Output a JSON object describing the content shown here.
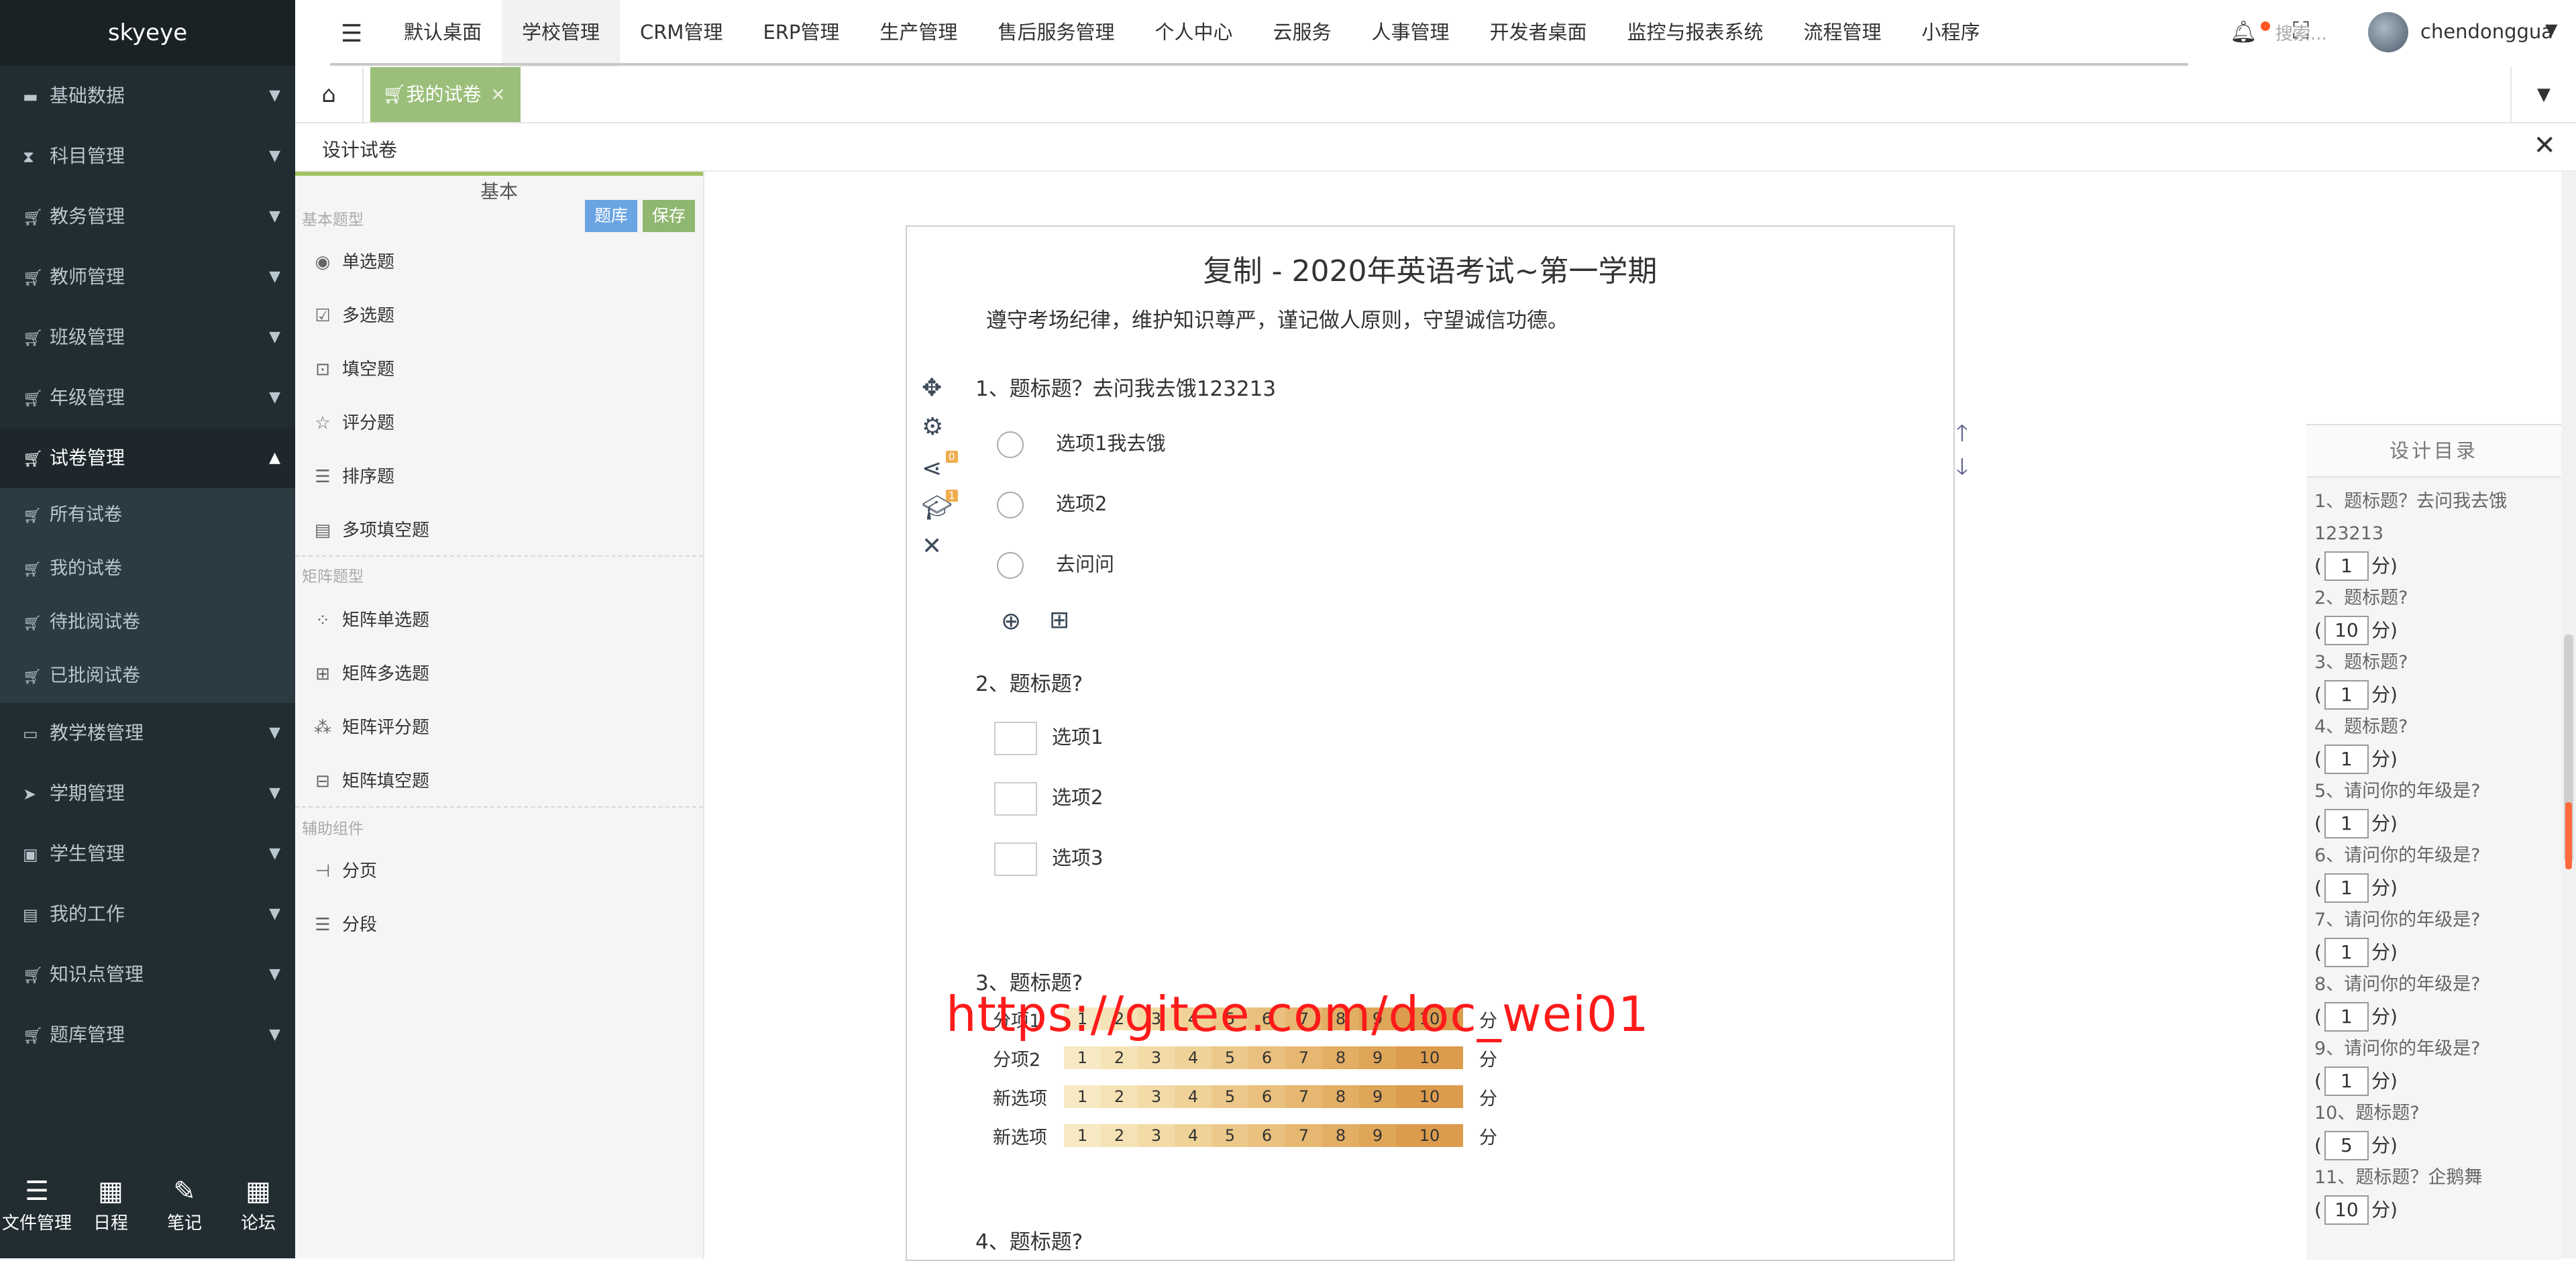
{
  "brand": "skyeye",
  "sidebar": {
    "items": [
      {
        "label": "基础数据",
        "icon": "folder-icon"
      },
      {
        "label": "科目管理",
        "icon": "hourglass-icon"
      },
      {
        "label": "教务管理",
        "icon": "cart-icon"
      },
      {
        "label": "教师管理",
        "icon": "cart-icon"
      },
      {
        "label": "班级管理",
        "icon": "cart-icon"
      },
      {
        "label": "年级管理",
        "icon": "cart-icon"
      },
      {
        "label": "试卷管理",
        "icon": "cart-icon",
        "open": true
      },
      {
        "label": "教学楼管理",
        "icon": "folder-open-icon"
      },
      {
        "label": "学期管理",
        "icon": "paper-plane-icon"
      },
      {
        "label": "学生管理",
        "icon": "id-badge-icon"
      },
      {
        "label": "我的工作",
        "icon": "archive-icon"
      },
      {
        "label": "知识点管理",
        "icon": "cart-icon"
      },
      {
        "label": "题库管理",
        "icon": "cart-icon"
      }
    ],
    "sub_items": [
      "所有试卷",
      "我的试卷",
      "待批阅试卷",
      "已批阅试卷"
    ],
    "bottom_tools": [
      "文件管理",
      "日程",
      "笔记",
      "论坛"
    ]
  },
  "topbar": {
    "menus": [
      "默认桌面",
      "学校管理",
      "CRM管理",
      "ERP管理",
      "生产管理",
      "售后服务管理",
      "个人中心",
      "云服务",
      "人事管理",
      "开发者桌面",
      "监控与报表系统",
      "流程管理",
      "小程序"
    ],
    "active_menu": "学校管理",
    "search_placeholder": "搜索...",
    "username": "chendonggua"
  },
  "tabs": {
    "active_tab": "我的试卷"
  },
  "subheader": {
    "title": "设计试卷"
  },
  "palette": {
    "basic_label": "基本",
    "btn_bank": "题库",
    "btn_save": "保存",
    "sec_basic": "基本题型",
    "basic_items": [
      "单选题",
      "多选题",
      "填空题",
      "评分题",
      "排序题",
      "多项填空题"
    ],
    "sec_matrix": "矩阵题型",
    "matrix_items": [
      "矩阵单选题",
      "矩阵多选题",
      "矩阵评分题",
      "矩阵填空题"
    ],
    "sec_aux": "辅助组件",
    "aux_items": [
      "分页",
      "分段"
    ],
    "colors": {
      "bank": "#5b9bd5",
      "save": "#8fb771"
    }
  },
  "paper": {
    "title": "复制 - 2020年英语考试~第一学期",
    "description": "遵守考场纪律，维护知识尊严，谨记做人原则，守望诚信功德。",
    "q1": {
      "title": "1、题标题？去问我去饿123213",
      "options": [
        "选项1我去饿",
        "选项2",
        "去问问"
      ],
      "badge_share": "0",
      "badge_cap": "1"
    },
    "q2": {
      "title": "2、题标题?",
      "options": [
        "选项1",
        "选项2",
        "选项3"
      ]
    },
    "q3": {
      "title": "3、题标题?",
      "rows": [
        "分项1",
        "分项2",
        "新选项",
        "新选项"
      ],
      "scale": [
        "1",
        "2",
        "3",
        "4",
        "5",
        "6",
        "7",
        "8",
        "9",
        "10"
      ],
      "unit": "分"
    },
    "q4": {
      "title": "4、题标题?"
    },
    "watermark": "https://gitee.com/doc_wei01"
  },
  "catalog": {
    "title": "设计目录",
    "score_prefix": "(",
    "score_suffix": "分)",
    "entries": [
      {
        "title": "1、题标题？去问我去饿123213",
        "score": "1"
      },
      {
        "title": "2、题标题?",
        "score": "10"
      },
      {
        "title": "3、题标题?",
        "score": "1"
      },
      {
        "title": "4、题标题?",
        "score": "1"
      },
      {
        "title": "5、请问你的年级是?",
        "score": "1"
      },
      {
        "title": "6、请问你的年级是?",
        "score": "1"
      },
      {
        "title": "7、请问你的年级是?",
        "score": "1"
      },
      {
        "title": "8、请问你的年级是?",
        "score": "1"
      },
      {
        "title": "9、请问你的年级是?",
        "score": "1"
      },
      {
        "title": "10、题标题?",
        "score": "5"
      },
      {
        "title": "11、题标题？企鹅舞",
        "score": "10"
      }
    ]
  }
}
